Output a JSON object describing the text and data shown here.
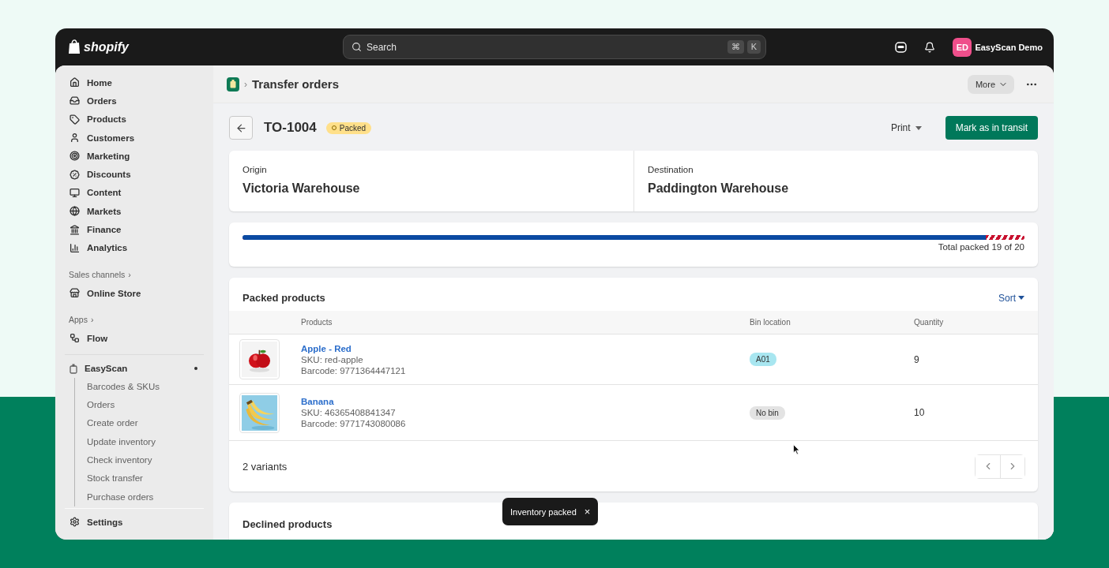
{
  "topbar": {
    "logo": "shopify",
    "search": {
      "placeholder": "Search",
      "keys": [
        "⌘",
        "K"
      ]
    },
    "user": {
      "initials": "ED",
      "name": "EasyScan Demo"
    }
  },
  "sidebar": {
    "items": [
      {
        "label": "Home"
      },
      {
        "label": "Orders"
      },
      {
        "label": "Products"
      },
      {
        "label": "Customers"
      },
      {
        "label": "Marketing"
      },
      {
        "label": "Discounts"
      },
      {
        "label": "Content"
      },
      {
        "label": "Markets"
      },
      {
        "label": "Finance"
      },
      {
        "label": "Analytics"
      }
    ],
    "sales_channels": {
      "heading": "Sales channels",
      "chevron": "›",
      "items": [
        "Online Store"
      ]
    },
    "apps": {
      "heading": "Apps",
      "chevron": "›",
      "items": [
        "Flow"
      ]
    },
    "app": {
      "name": "EasyScan",
      "dot": true,
      "children": [
        "Barcodes & SKUs",
        "Orders",
        "Create order",
        "Update inventory",
        "Check inventory",
        "Stock transfer",
        "Purchase orders"
      ]
    },
    "settings": "Settings"
  },
  "breadcrumb": {
    "separator": "›",
    "title": "Transfer orders",
    "more": "More"
  },
  "header": {
    "title": "TO-1004",
    "status": "Packed",
    "print": "Print",
    "primary": "Mark as in transit"
  },
  "route": [
    {
      "label": "Origin",
      "value": "Victoria Warehouse"
    },
    {
      "label": "Destination",
      "value": "Paddington Warehouse"
    }
  ],
  "progress": {
    "level": 0.95,
    "text": "Total packed 19 of 20"
  },
  "packed": {
    "title": "Packed products",
    "sort": "Sort",
    "columns": [
      "Products",
      "Bin location",
      "Quantity"
    ],
    "rows": [
      {
        "name": "Apple - Red",
        "sku": "SKU: red-apple",
        "barcode": "Barcode: 9771364447121",
        "bin": {
          "label": "A01",
          "kind": "assigned"
        },
        "quantity": "9"
      },
      {
        "name": "Banana",
        "sku": "SKU: 46365408841347",
        "barcode": "Barcode: 9771743080086",
        "bin": {
          "label": "No bin",
          "kind": "none"
        },
        "quantity": "10"
      }
    ],
    "footer": "2 variants"
  },
  "declined": {
    "title": "Declined products"
  },
  "toast": {
    "message": "Inventory packed",
    "close": "×"
  }
}
